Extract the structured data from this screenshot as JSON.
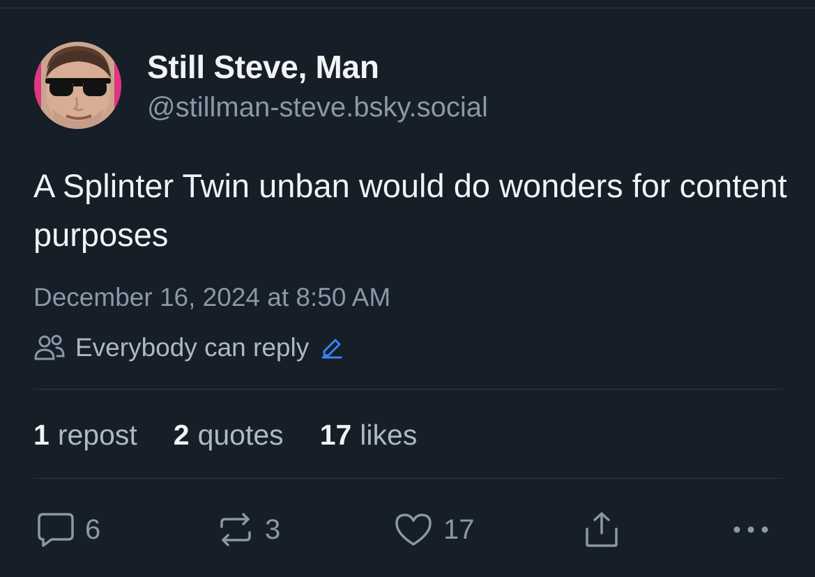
{
  "post": {
    "author": {
      "display_name": "Still Steve, Man",
      "handle": "@stillman-steve.bsky.social"
    },
    "text": "A Splinter Twin unban would do wonders for content purposes",
    "timestamp": "December 16, 2024 at 8:50 AM",
    "reply_setting": "Everybody can reply",
    "stats": {
      "reposts": {
        "count": "1",
        "label": "repost"
      },
      "quotes": {
        "count": "2",
        "label": "quotes"
      },
      "likes": {
        "count": "17",
        "label": "likes"
      }
    },
    "actions": {
      "reply_count": "6",
      "repost_count": "3",
      "like_count": "17"
    }
  },
  "colors": {
    "background": "#161e27",
    "primary_text": "#f1f3f5",
    "secondary_text": "#8b98a8",
    "accent": "#3b82f6",
    "avatar_border": "#e0357f"
  }
}
